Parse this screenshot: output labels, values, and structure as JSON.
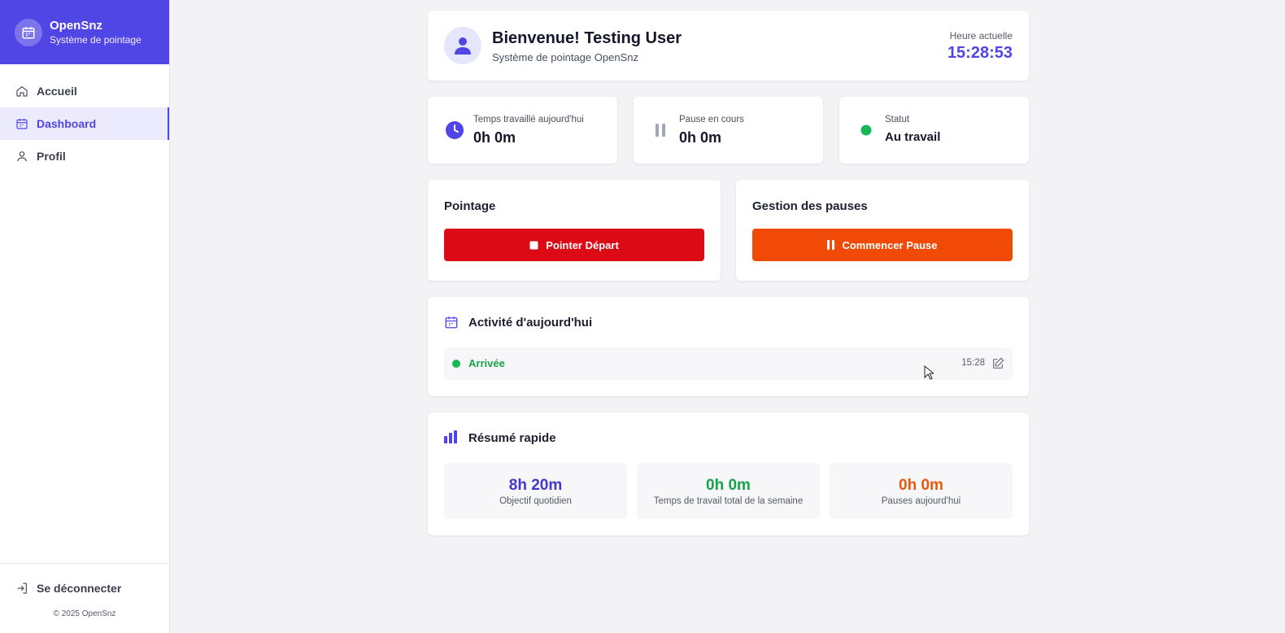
{
  "brand": {
    "name": "OpenSnz",
    "subtitle": "Système de pointage"
  },
  "nav": {
    "items": [
      {
        "label": "Accueil",
        "icon": "home-icon",
        "active": false
      },
      {
        "label": "Dashboard",
        "icon": "calendar-icon",
        "active": true
      },
      {
        "label": "Profil",
        "icon": "user-icon",
        "active": false
      }
    ],
    "logout_label": "Se déconnecter",
    "copyright": "© 2025 OpenSnz"
  },
  "welcome": {
    "title": "Bienvenue! Testing User",
    "subtitle": "Système de pointage OpenSnz",
    "time_label": "Heure actuelle",
    "time_value": "15:28:53"
  },
  "stats": [
    {
      "label": "Temps travaillé aujourd'hui",
      "value": "0h 0m",
      "icon": "clock-icon"
    },
    {
      "label": "Pause en cours",
      "value": "0h 0m",
      "icon": "pause-icon"
    },
    {
      "label": "Statut",
      "value": "Au travail",
      "icon": "status-dot-icon"
    }
  ],
  "pointage": {
    "title": "Pointage",
    "button_label": "Pointer Départ"
  },
  "pauses": {
    "title": "Gestion des pauses",
    "button_label": "Commencer Pause"
  },
  "activity": {
    "title": "Activité d'aujourd'hui",
    "entries": [
      {
        "label": "Arrivée",
        "time": "15:28"
      }
    ]
  },
  "summary": {
    "title": "Résumé rapide",
    "items": [
      {
        "value": "8h 20m",
        "label": "Objectif quotidien",
        "color": "#4338ca"
      },
      {
        "value": "0h 0m",
        "label": "Temps de travail total de la semaine",
        "color": "#16a34a"
      },
      {
        "value": "0h 0m",
        "label": "Pauses aujourd'hui",
        "color": "#ea580c"
      }
    ]
  },
  "colors": {
    "primary": "#4f46e5",
    "danger": "#dc0a14",
    "warning": "#f04a06",
    "success": "#16b955"
  }
}
